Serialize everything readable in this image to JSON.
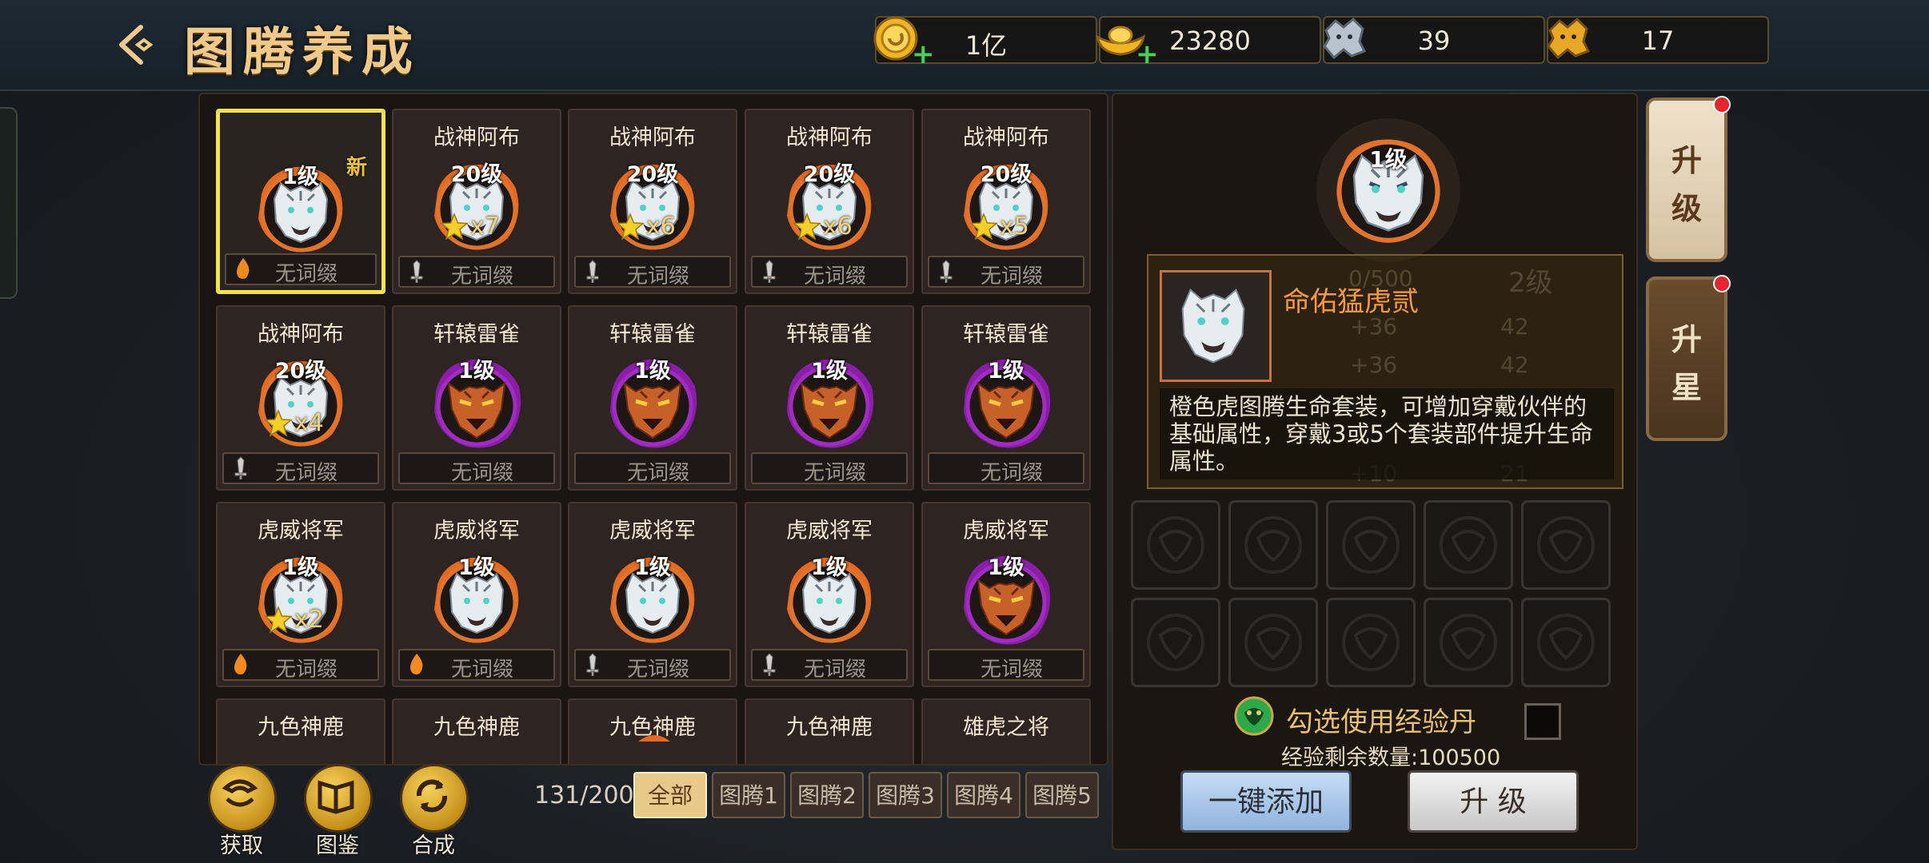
{
  "header": {
    "title": "图腾养成",
    "back_icon": "back-arrow-icon",
    "resources": [
      {
        "icon": "gold-coin-icon",
        "value": "1亿",
        "has_plus": true
      },
      {
        "icon": "gold-ingot-icon",
        "value": "23280",
        "has_plus": true
      },
      {
        "icon": "silver-beast-icon",
        "value": "39",
        "has_plus": false
      },
      {
        "icon": "gold-beast-icon",
        "value": "17",
        "has_plus": false
      }
    ]
  },
  "cards": [
    {
      "name": "",
      "level": "1级",
      "new": "新",
      "stars": "",
      "affix": "无词缀",
      "affix_icon": "flame",
      "medal": "tiger-orange",
      "selected": true
    },
    {
      "name": "战神阿布",
      "level": "20级",
      "new": "",
      "stars": "x7",
      "affix": "无词缀",
      "affix_icon": "sword",
      "medal": "tiger-orange"
    },
    {
      "name": "战神阿布",
      "level": "20级",
      "new": "",
      "stars": "x6",
      "affix": "无词缀",
      "affix_icon": "sword",
      "medal": "tiger-orange"
    },
    {
      "name": "战神阿布",
      "level": "20级",
      "new": "",
      "stars": "x6",
      "affix": "无词缀",
      "affix_icon": "sword",
      "medal": "tiger-orange"
    },
    {
      "name": "战神阿布",
      "level": "20级",
      "new": "",
      "stars": "x5",
      "affix": "无词缀",
      "affix_icon": "sword",
      "medal": "tiger-orange"
    },
    {
      "name": "战神阿布",
      "level": "20级",
      "new": "",
      "stars": "x4",
      "affix": "无词缀",
      "affix_icon": "sword",
      "medal": "tiger-orange"
    },
    {
      "name": "轩辕雷雀",
      "level": "1级",
      "new": "",
      "stars": "",
      "affix": "无词缀",
      "affix_icon": "",
      "medal": "wolf-purple"
    },
    {
      "name": "轩辕雷雀",
      "level": "1级",
      "new": "",
      "stars": "",
      "affix": "无词缀",
      "affix_icon": "",
      "medal": "wolf-purple"
    },
    {
      "name": "轩辕雷雀",
      "level": "1级",
      "new": "",
      "stars": "",
      "affix": "无词缀",
      "affix_icon": "",
      "medal": "wolf-purple"
    },
    {
      "name": "轩辕雷雀",
      "level": "1级",
      "new": "",
      "stars": "",
      "affix": "无词缀",
      "affix_icon": "",
      "medal": "wolf-purple"
    },
    {
      "name": "虎威将军",
      "level": "1级",
      "new": "",
      "stars": "x2",
      "affix": "无词缀",
      "affix_icon": "flame",
      "medal": "tiger-orange"
    },
    {
      "name": "虎威将军",
      "level": "1级",
      "new": "",
      "stars": "",
      "affix": "无词缀",
      "affix_icon": "flame",
      "medal": "tiger-orange"
    },
    {
      "name": "虎威将军",
      "level": "1级",
      "new": "",
      "stars": "",
      "affix": "无词缀",
      "affix_icon": "sword",
      "medal": "tiger-orange"
    },
    {
      "name": "虎威将军",
      "level": "1级",
      "new": "",
      "stars": "",
      "affix": "无词缀",
      "affix_icon": "sword",
      "medal": "tiger-orange"
    },
    {
      "name": "虎威将军",
      "level": "1级",
      "new": "",
      "stars": "",
      "affix": "无词缀",
      "affix_icon": "",
      "medal": "wolf-purple"
    },
    {
      "name": "九色神鹿",
      "partial": true
    },
    {
      "name": "九色神鹿",
      "partial": true
    },
    {
      "name": "九色神鹿",
      "partial": true
    },
    {
      "name": "九色神鹿",
      "partial": true
    },
    {
      "name": "雄虎之将",
      "partial": true
    }
  ],
  "bottom": {
    "buttons": [
      {
        "label": "获取",
        "icon": "acquire-icon"
      },
      {
        "label": "图鉴",
        "icon": "codex-icon"
      },
      {
        "label": "合成",
        "icon": "synthesis-icon"
      }
    ],
    "count": "131/200",
    "tabs": [
      "全部",
      "图腾1",
      "图腾2",
      "图腾3",
      "图腾4",
      "图腾5"
    ]
  },
  "detail": {
    "top_level": "1级",
    "item_name": "命佑猛虎贰",
    "description": "橙色虎图腾生命套装，可增加穿戴伙伴的基础属性，穿戴3或5个套装部件提升生命属性。",
    "ghost_text": {
      "bar": "0/500",
      "next_level": "2级",
      "row1_left": "+36",
      "row1_right": "42",
      "row2_left": "+36",
      "row2_right": "42",
      "row3_right": "21",
      "row4_left": "+10"
    },
    "exp_label": "勾选使用经验丹",
    "exp_count": "经验剩余数量:100500",
    "add_button": "一键添加",
    "upgrade_button": "升 级"
  },
  "side_buttons": [
    {
      "label_top": "升",
      "label_bottom": "级",
      "has_dot": true
    },
    {
      "label_top": "升",
      "label_bottom": "星",
      "has_dot": true
    }
  ],
  "colors": {
    "accent_gold": "#f1c98a",
    "select_yellow": "#f4e24e",
    "orange_name": "#ff9a40",
    "purple_rim": "#8a1ea8"
  }
}
